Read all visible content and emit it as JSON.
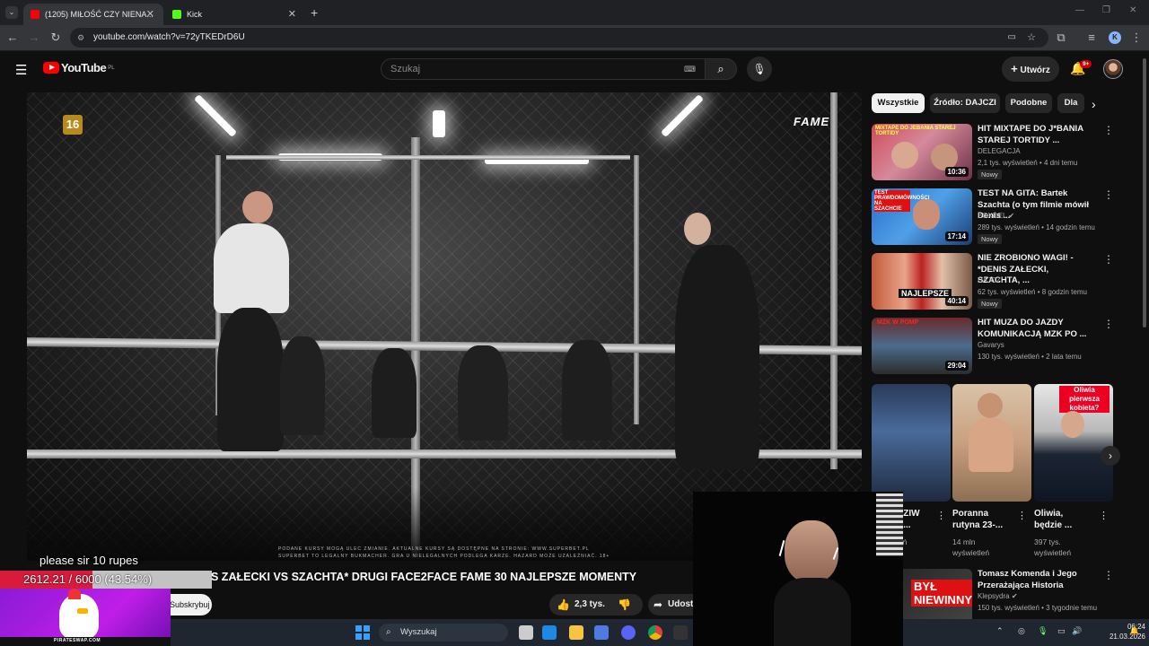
{
  "browser": {
    "tabs": [
      {
        "label": "(1205) MIŁOŚĆ CZY NIENA...",
        "active": true,
        "color": "#ff0000"
      },
      {
        "label": "Kick",
        "active": false,
        "color": "#53fc18"
      }
    ],
    "new_tab": "+",
    "url": "youtube.com/watch?v=72yTKEDrD6U",
    "profile_initial": "K"
  },
  "yt": {
    "logo_text": "YouTube",
    "logo_region": "PL",
    "search_placeholder": "Szukaj",
    "create_label": "Utwórz",
    "notif_count": "9+"
  },
  "video": {
    "age_badge": "16",
    "brand": "FAME",
    "disclaimer": "PODANE KURSY MOGĄ ULEC ZMIANIE. AKTUALNE KURSY SĄ DOSTĘPNE NA STRONIE: WWW.SUPERBET.PL",
    "disclaimer2": "SUPERBET TO LEGALNY BUKMACHER. GRA U NIELEGALNYCH PODLEGA KARZE. HAZARD MOŻE UZALEŻNIAĆ. 18+",
    "title": "S ZAŁECKI VS SZACHTA* DRUGI FACE2FACE FAME 30 NAJLEPSZE MOMENTY",
    "subscribe_label": "Subskrybuj",
    "likes": "2,3 tys.",
    "share_label": "Udost"
  },
  "chips": [
    "Wszystkie",
    "Źródło: DAJCZI",
    "Podobne",
    "Dla"
  ],
  "recommendations": [
    {
      "title": "HIT MIXTAPE DO J*BANIA STAREJ TORTIDY ...",
      "channel": "DELEGACJA",
      "meta": "2,1 tys. wyświetleń • 4 dni temu",
      "badge": "Nowy",
      "duration": "10:36",
      "thumb_text": "MIXTAPE DO JEBANIA STAREJ TORTIDY"
    },
    {
      "title": "TEST NA GITA: Bartek Szachta (o tym filmie mówił Denis ...",
      "channel": "BOXDEL",
      "meta": "289 tys. wyświetleń • 14 godzin temu",
      "badge": "Nowy",
      "duration": "17:14",
      "thumb_text": "TEST PRAWDOMÓWNOŚCI NA SZACHCIE"
    },
    {
      "title": "NIE ZROBIONO WAGI! - *DENIS ZAŁECKI, SZACHTA, ...",
      "channel": "DAJCZI",
      "meta": "62 tys. wyświetleń • 8 godzin temu",
      "badge": "Nowy",
      "duration": "40:14",
      "thumb_text": "NAJLEPSZE"
    },
    {
      "title": "HIT MUZA DO JAZDY KOMUNIKACJĄ MZK PO ...",
      "channel": "Gavarys",
      "meta": "130 tys. wyświetleń • 2 lata temu",
      "badge": "",
      "duration": "29:04",
      "thumb_text": "MZK W POMP"
    },
    {
      "title": "Tomasz Komenda i Jego Przerażająca Historia",
      "channel": "Klepsydra",
      "meta": "150 tys. wyświetleń • 3 tygodnie temu",
      "badge": "",
      "duration": "",
      "thumb_text": "BYŁ NIEWINNY"
    }
  ],
  "shorts": [
    {
      "title": "DZIW K...",
      "views": "ień"
    },
    {
      "title": "Poranna rutyna 23-...",
      "views": "14 mln wyświetleń"
    },
    {
      "title": "Oliwia, będzie ...",
      "views": "397 tys. wyświetleń",
      "tag": "Oliwia pierwsza kobieta?"
    }
  ],
  "taskbar": {
    "search_label": "Wyszukaj",
    "time": "06:24",
    "date": "21.03.2026"
  },
  "stream_overlay": {
    "message": "please sir 10 rupes",
    "goal_current": "2612.21",
    "goal_rest": "/ 6000 (43.54%)",
    "goal_fraction": 0.4354,
    "sponsor": "PIRATESWAP.COM"
  }
}
